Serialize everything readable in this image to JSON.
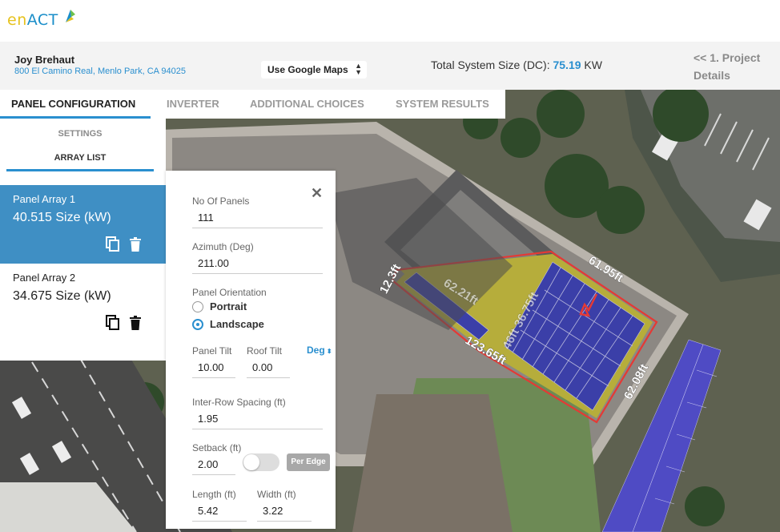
{
  "logo": {
    "part1": "en",
    "part2": "ACT"
  },
  "customer": {
    "name": "Joy Brehaut",
    "address": "800 El Camino Real, Menlo Park, CA 94025"
  },
  "map_source": {
    "selected": "Use Google Maps"
  },
  "system_size": {
    "label": "Total System Size (DC): ",
    "value": "75.19",
    "unit": " KW"
  },
  "nav_back": {
    "label": "<< 1. Project Details"
  },
  "tabs": [
    {
      "label": "PANEL CONFIGURATION",
      "active": true
    },
    {
      "label": "INVERTER",
      "active": false
    },
    {
      "label": "ADDITIONAL CHOICES",
      "active": false
    },
    {
      "label": "SYSTEM RESULTS",
      "active": false
    }
  ],
  "subtabs": {
    "settings": "SETTINGS",
    "array_list": "ARRAY LIST"
  },
  "arrays": [
    {
      "name": "Panel Array 1",
      "size": "40.515 Size (kW)"
    },
    {
      "name": "Panel Array 2",
      "size": "34.675 Size (kW)"
    }
  ],
  "form": {
    "close": "✕",
    "panels_label": "No Of Panels",
    "panels_value": "111",
    "azimuth_label": "Azimuth (Deg)",
    "azimuth_value": "211.00",
    "orientation_label": "Panel Orientation",
    "portrait": "Portrait",
    "landscape": "Landscape",
    "tilt_label": "Panel Tilt",
    "tilt_value": "10.00",
    "roof_tilt_label": "Roof Tilt",
    "roof_tilt_value": "0.00",
    "unit_select": "Deg",
    "spacing_label": "Inter-Row Spacing (ft)",
    "spacing_value": "1.95",
    "setback_label": "Setback (ft)",
    "setback_value": "2.00",
    "per_edge": "Per Edge",
    "length_label": "Length (ft)",
    "length_value": "5.42",
    "width_label": "Width (ft)",
    "width_value": "3.22"
  },
  "map_labels": {
    "top": "61.95ft",
    "bottom": "123.65ft",
    "right": "62.08ft",
    "left": "12.3ft",
    "inner1": "62.21ft",
    "inner2": "46ft 36.75ft"
  },
  "colors": {
    "accent": "#2a8fcf",
    "roof_outline": "#e53935",
    "array_fill": "#b6ad3b",
    "panel": "#3b3fa8"
  }
}
